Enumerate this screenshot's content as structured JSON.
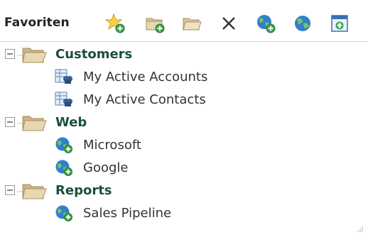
{
  "toolbar": {
    "title": "Favoriten",
    "buttons": [
      {
        "name": "add-favorite-button",
        "icon": "star-add-icon"
      },
      {
        "name": "add-folder-button",
        "icon": "folder-add-icon"
      },
      {
        "name": "open-folder-button",
        "icon": "folder-open-icon"
      },
      {
        "name": "delete-button",
        "icon": "close-icon"
      },
      {
        "name": "add-web-link-button",
        "icon": "globe-add-icon"
      },
      {
        "name": "web-link-button",
        "icon": "globe-icon"
      },
      {
        "name": "open-window-button",
        "icon": "window-up-icon"
      }
    ]
  },
  "tree": {
    "folders": [
      {
        "label": "Customers",
        "items": [
          {
            "label": "My Active Accounts",
            "icon": "view-grid-icon"
          },
          {
            "label": "My Active Contacts",
            "icon": "view-grid-icon"
          }
        ]
      },
      {
        "label": "Web",
        "items": [
          {
            "label": "Microsoft",
            "icon": "globe-add-icon"
          },
          {
            "label": "Google",
            "icon": "globe-add-icon"
          }
        ]
      },
      {
        "label": "Reports",
        "items": [
          {
            "label": "Sales Pipeline",
            "icon": "globe-add-icon"
          }
        ]
      }
    ]
  },
  "colors": {
    "folder_label": "#1d4f3a",
    "item_label": "#333333",
    "folder_tan": "#d9c49a",
    "globe_blue": "#2f7fd0",
    "globe_green": "#3aa34a"
  }
}
